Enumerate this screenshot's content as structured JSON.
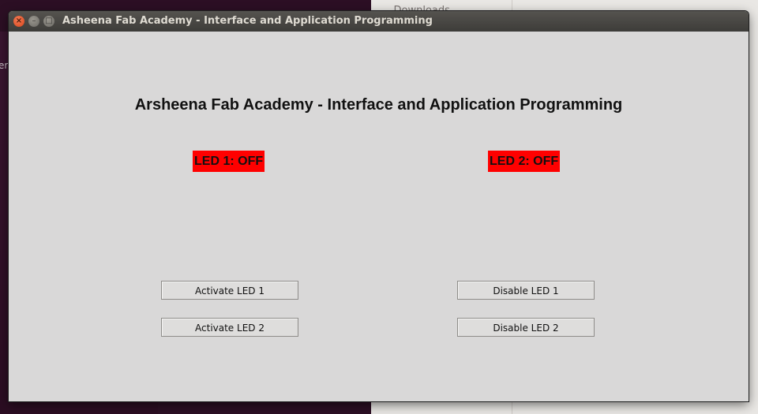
{
  "window": {
    "title": "Asheena Fab Academy - Interface and Application Programming",
    "controls": {
      "close_glyph": "×",
      "minimize_glyph": "–",
      "maximize_glyph": "□"
    }
  },
  "background": {
    "left_edge_text": "er",
    "right_window_fragment": "... Downloads"
  },
  "app": {
    "heading": "Arsheena Fab Academy - Interface and Application Programming",
    "led1_status": "LED 1: OFF",
    "led2_status": "LED 2: OFF",
    "status_color": "#ff0000",
    "buttons": {
      "activate_led1": "Activate LED 1",
      "activate_led2": "Activate LED 2",
      "disable_led1": "Disable LED 1",
      "disable_led2": "Disable LED 2"
    }
  }
}
